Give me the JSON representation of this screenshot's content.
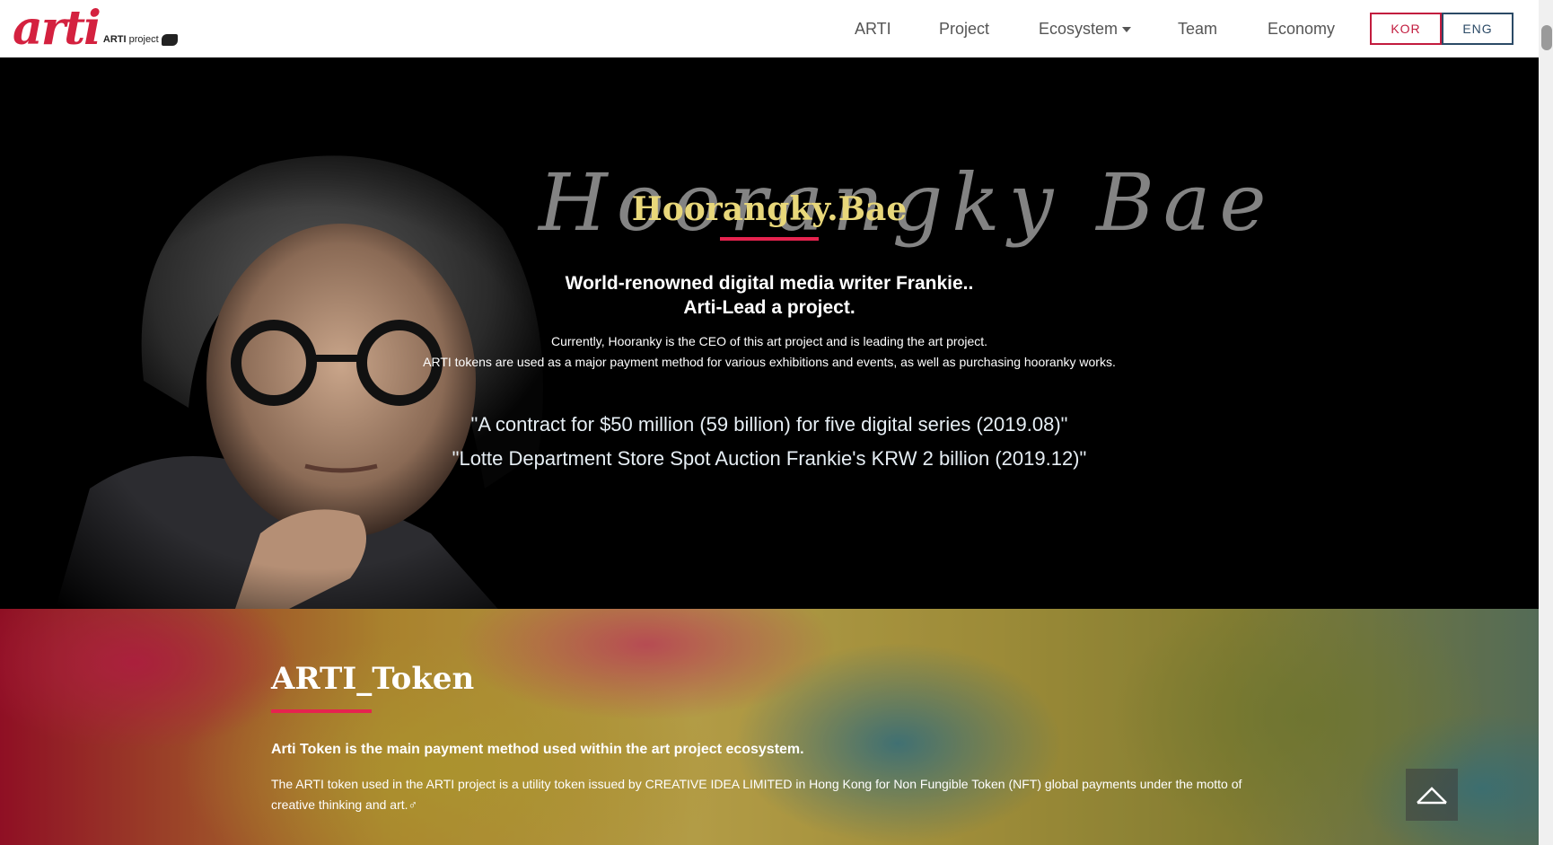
{
  "header": {
    "logo_text": "arti",
    "logo_sub_bold": "ARTI",
    "logo_sub": "project",
    "nav": [
      {
        "label": "ARTI"
      },
      {
        "label": "Project"
      },
      {
        "label": "Ecosystem"
      },
      {
        "label": "Team"
      },
      {
        "label": "Economy"
      }
    ],
    "lang": {
      "kor": "KOR",
      "eng": "ENG"
    }
  },
  "hero": {
    "signature": "Hoorangky Bae",
    "title": "Hoorangky.Bae",
    "subtitle_line1": "World-renowned digital media writer Frankie..",
    "subtitle_line2": "Arti-Lead a project.",
    "desc_line1": "Currently, Hooranky is the CEO of this art project and is leading the art project.",
    "desc_line2": "ARTI tokens are used as a major payment method for various exhibitions and events, as well as purchasing hooranky works.",
    "quote1": "\"A contract for $50 million (59 billion) for five digital series (2019.08)\"",
    "quote2": "\"Lotte Department Store Spot Auction Frankie's KRW 2 billion (2019.12)\""
  },
  "token": {
    "title": "ARTI_Token",
    "lead": "Arti Token is the main payment method used within the art project ecosystem.",
    "desc": "The ARTI token used in the ARTI project is a utility token issued by CREATIVE IDEA LIMITED in Hong Kong for Non Fungible Token (NFT) global payments under the motto of creative thinking and art.♂"
  },
  "colors": {
    "brand_red": "#d4213f",
    "accent_underline": "#e6234f",
    "hero_title": "#e8d77a"
  },
  "icons": {
    "back_to_top": "chevron-up-icon",
    "dropdown": "caret-down-icon"
  }
}
